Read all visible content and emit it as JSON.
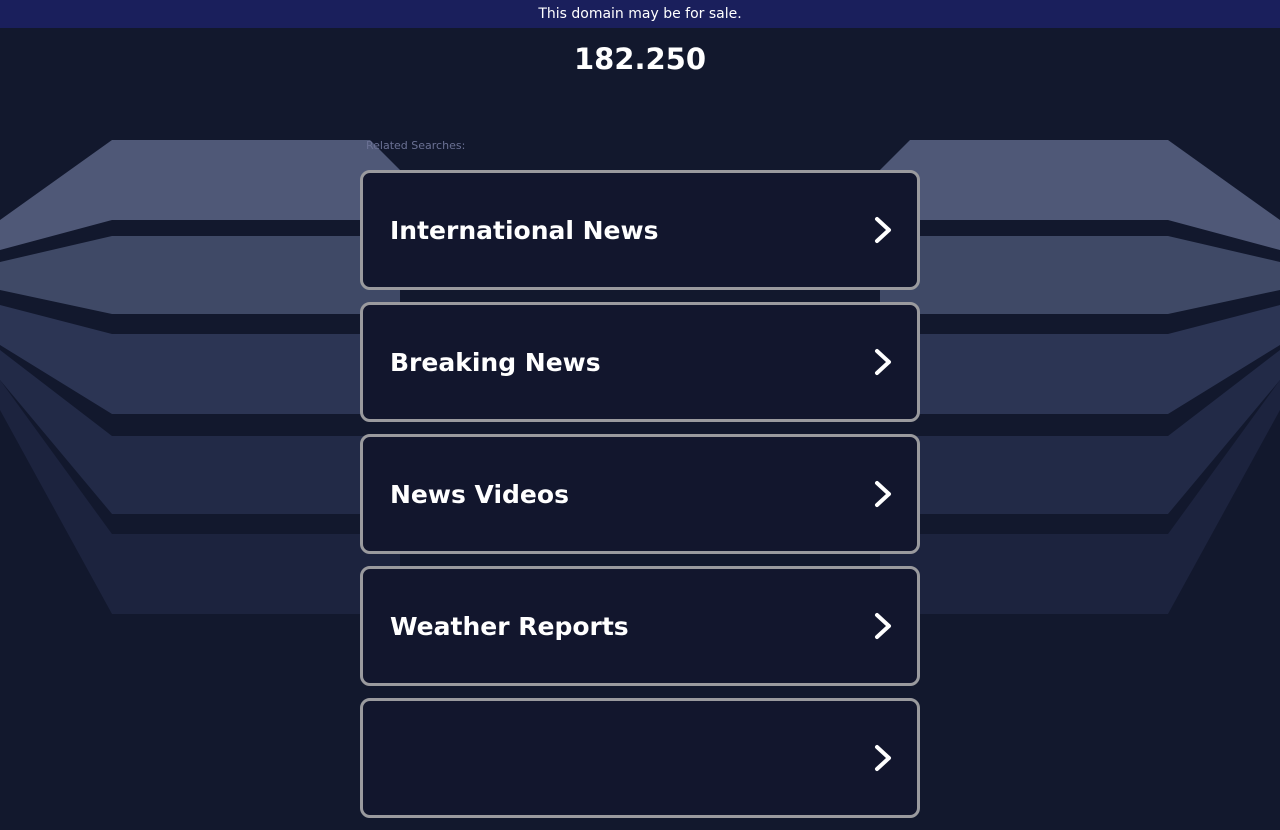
{
  "banner": {
    "text": "This domain may be for sale."
  },
  "header": {
    "domain": "182.250"
  },
  "related": {
    "label": "Related Searches:",
    "items": [
      {
        "label": "International News",
        "icon": "chevron-right-icon"
      },
      {
        "label": "Breaking News",
        "icon": "chevron-right-icon"
      },
      {
        "label": "News Videos",
        "icon": "chevron-right-icon"
      },
      {
        "label": "Weather Reports",
        "icon": "chevron-right-icon"
      },
      {
        "label": "",
        "icon": "chevron-right-icon"
      }
    ]
  },
  "colors": {
    "background": "#12182d",
    "banner": "#1a1f5c",
    "card_border": "#9a9a9e",
    "card_fill": "#12162d",
    "text": "#ffffff"
  }
}
